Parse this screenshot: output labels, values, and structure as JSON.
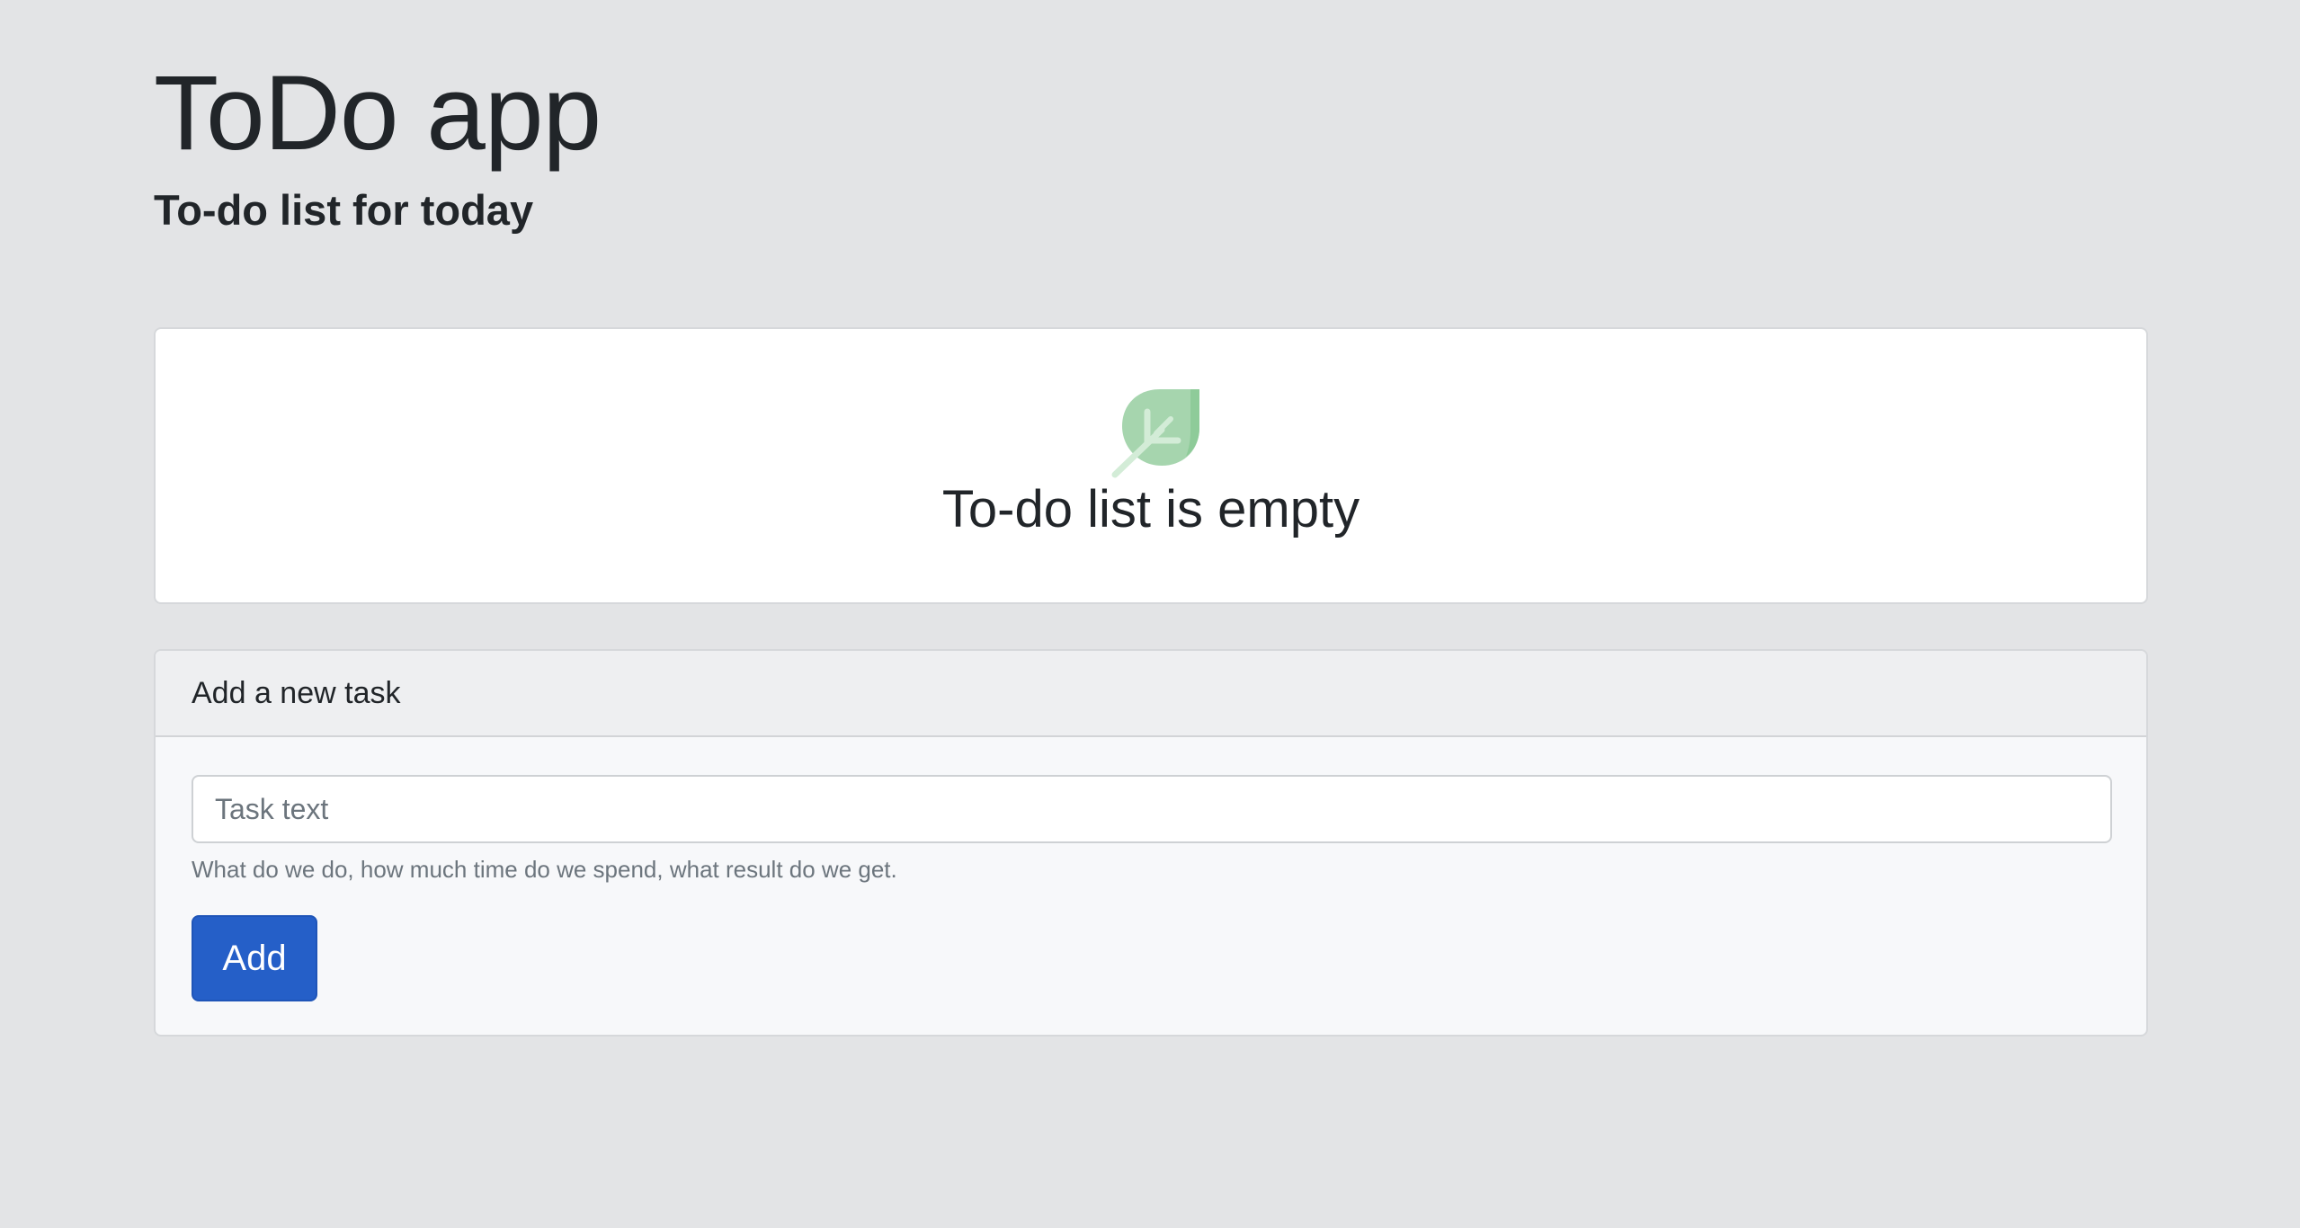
{
  "header": {
    "title": "ToDo app",
    "subtitle": "To-do list for today"
  },
  "empty_state": {
    "icon": "leaf-icon",
    "message": "To-do list is empty"
  },
  "new_task_form": {
    "header": "Add a new task",
    "input": {
      "value": "",
      "placeholder": "Task text"
    },
    "help_text": "What do we do, how much time do we spend, what result do we get.",
    "submit_label": "Add"
  },
  "colors": {
    "page_background": "#e3e4e6",
    "primary_button": "#255fc8",
    "leaf_green": "#a6d5ae"
  }
}
